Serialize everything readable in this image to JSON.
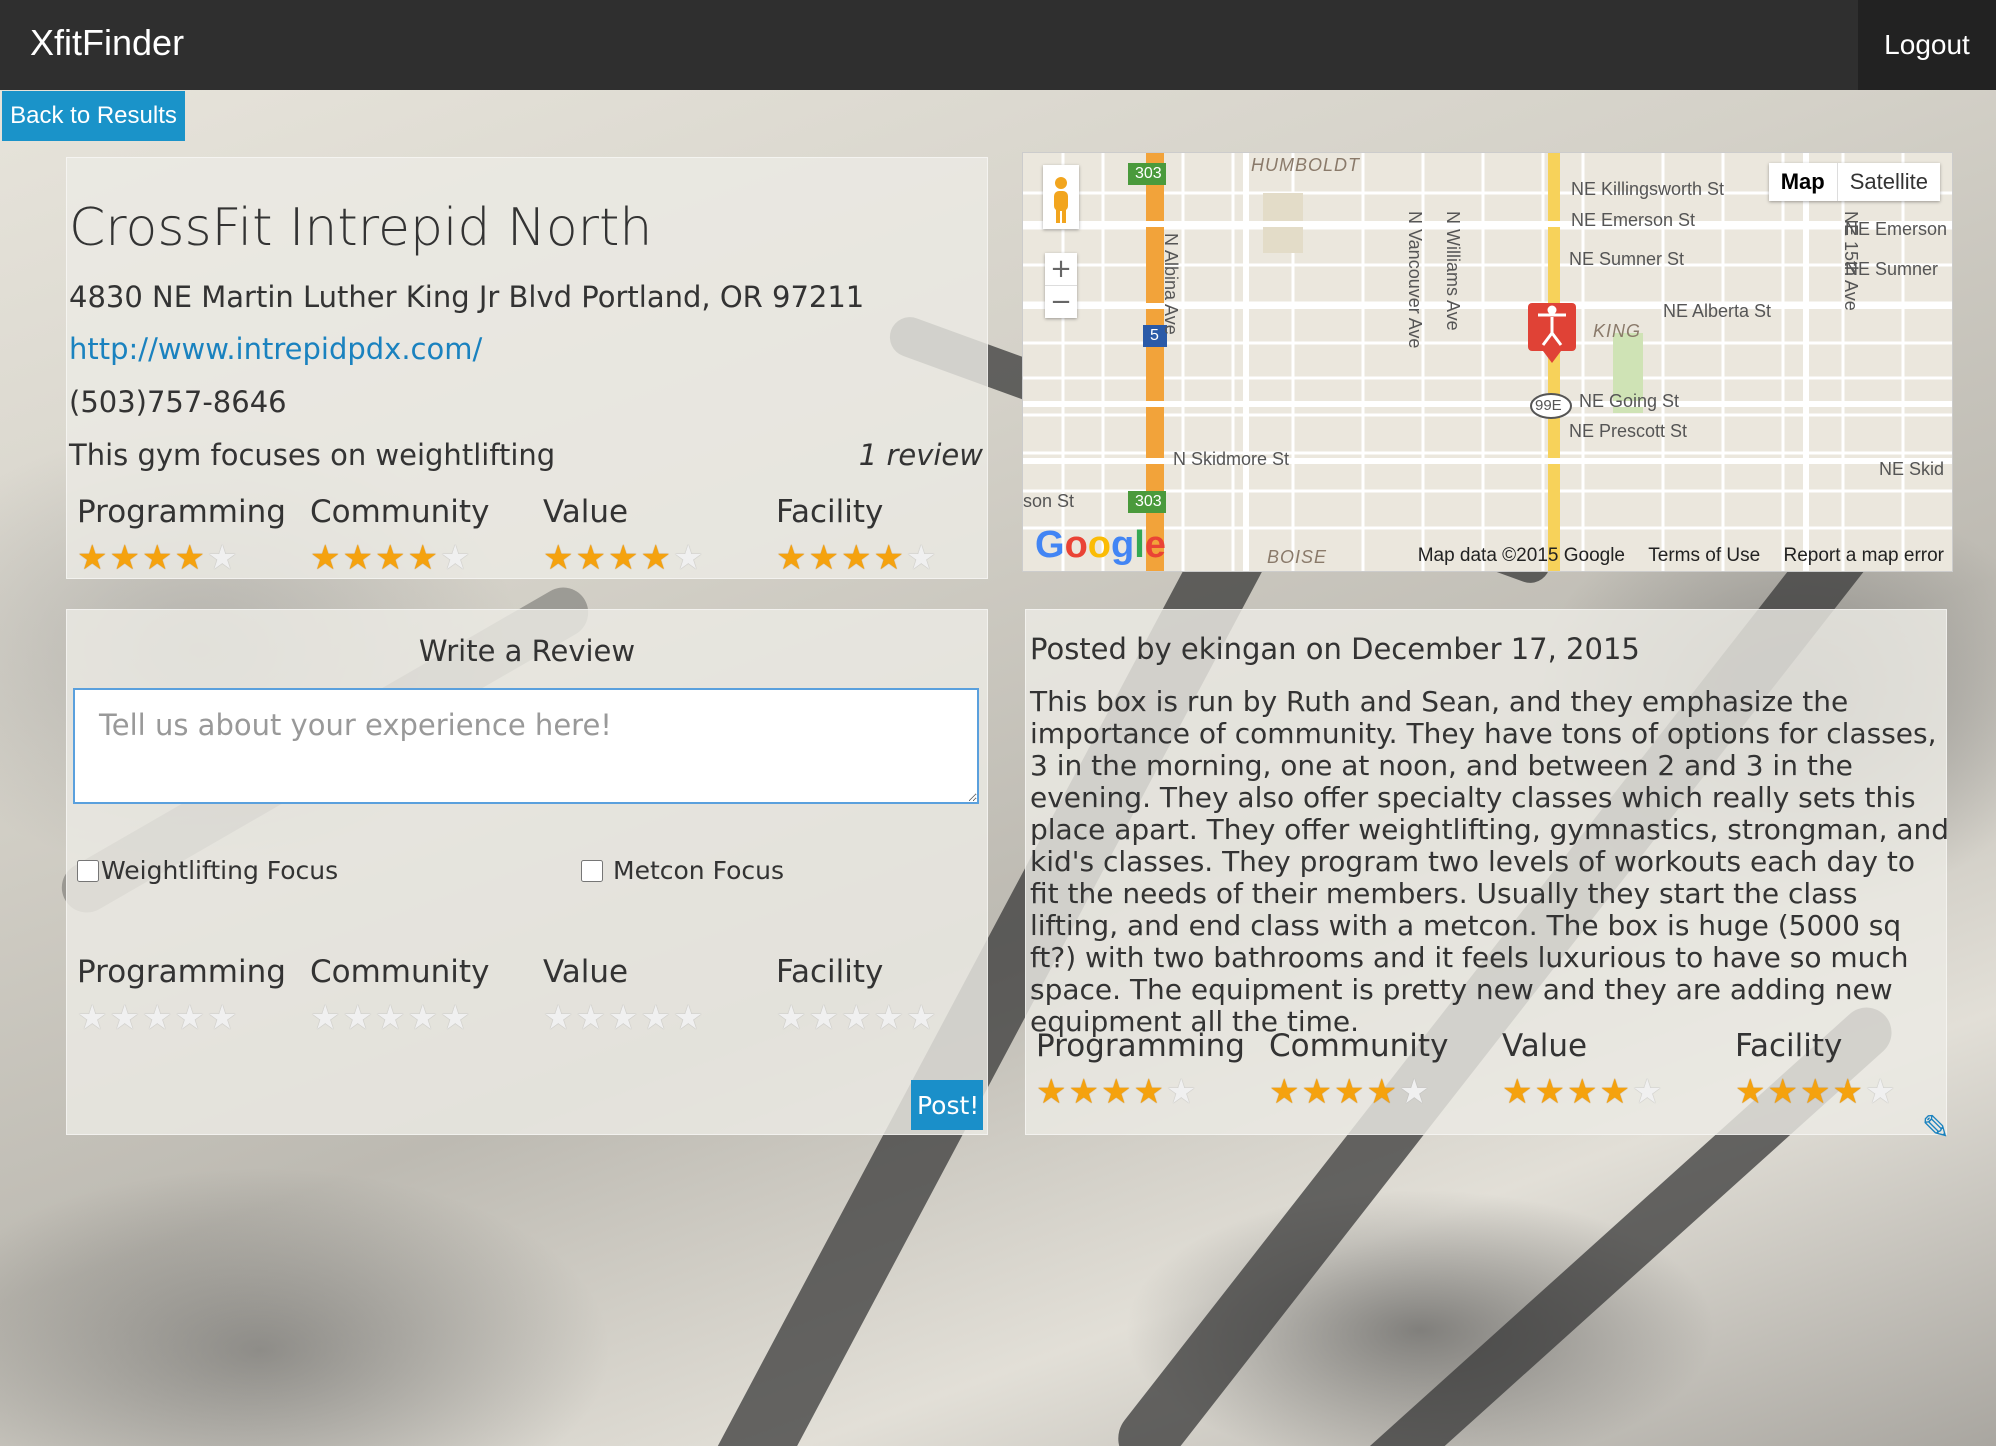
{
  "navbar": {
    "brand": "XfitFinder",
    "logout": "Logout"
  },
  "back_button": "Back to Results",
  "gym": {
    "name": "CrossFit Intrepid North",
    "address": "4830 NE Martin Luther King Jr Blvd Portland, OR 97211",
    "website": "http://www.intrepidpdx.com/",
    "phone": "(503)757-8646",
    "focus": "This gym focuses on weightlifting",
    "review_count": "1 review",
    "ratings": [
      {
        "label": "Programming",
        "score": 4
      },
      {
        "label": "Community",
        "score": 4
      },
      {
        "label": "Value",
        "score": 4
      },
      {
        "label": "Facility",
        "score": 4
      }
    ]
  },
  "map": {
    "map_button": "Map",
    "satellite_button": "Satellite",
    "footer": {
      "data": "Map data ©2015 Google",
      "terms": "Terms of Use",
      "report": "Report a map error"
    },
    "logo": "Google",
    "labels": {
      "humboldt": "HUMBOLDT",
      "killingsworth": "NE Killingsworth St",
      "emerson": "NE Emerson St",
      "emerson2": "NE Emerson",
      "sumner": "NE Sumner St",
      "sumner2": "NE Sumner",
      "alberta": "NE Alberta St",
      "king": "KING",
      "going": "NE Going St",
      "prescott": "NE Prescott St",
      "skidmore": "N Skidmore St",
      "skidmore2": "NE Skid",
      "boise": "BOISE",
      "albina": "N Albina Ave",
      "vancouver": "N Vancouver Ave",
      "williams": "N Williams Ave",
      "fifteenth": "NE 15th Ave",
      "hw303": "303",
      "hw5": "5",
      "hw99e": "99E",
      "sonst": "son St"
    }
  },
  "write_review": {
    "title": "Write a Review",
    "placeholder": "Tell us about your experience here!",
    "weightlifting": "Weightlifting Focus",
    "metcon": "Metcon Focus",
    "ratings": [
      {
        "label": "Programming",
        "score": 0
      },
      {
        "label": "Community",
        "score": 0
      },
      {
        "label": "Value",
        "score": 0
      },
      {
        "label": "Facility",
        "score": 0
      }
    ],
    "post": "Post!"
  },
  "review": {
    "posted_by": "Posted by ekingan on December 17, 2015",
    "body": "This box is run by Ruth and Sean, and they emphasize the importance of community. They have tons of options for classes, 3 in the morning, one at noon, and between 2 and 3 in the evening. They also offer specialty classes which really sets this place apart. They offer weightlifting, gymnastics, strongman, and kid's classes. They program two levels of workouts each day to fit the needs of their members. Usually they start the class lifting, and end class with a metcon. The box is huge (5000 sq ft?) with two bathrooms and it feels luxurious to have so much space. The equipment is pretty new and they are adding new equipment all the time.",
    "ratings": [
      {
        "label": "Programming",
        "score": 4
      },
      {
        "label": "Community",
        "score": 4
      },
      {
        "label": "Value",
        "score": 4
      },
      {
        "label": "Facility",
        "score": 4
      }
    ]
  },
  "colors": {
    "accent": "#1a93c9",
    "navbar": "#2f2f2f",
    "star": "#f5a20e"
  }
}
